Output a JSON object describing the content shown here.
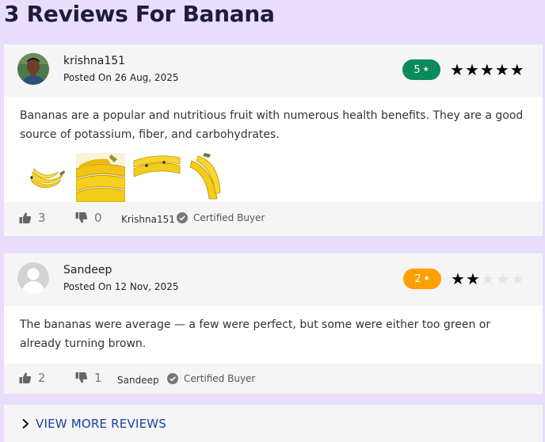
{
  "page": {
    "title": "3 Reviews For Banana"
  },
  "reviews": [
    {
      "author": "krishna151",
      "posted": "Posted On 26 Aug, 2025",
      "rating_badge": "5",
      "rating": 5,
      "max_rating": 5,
      "badge_color": "#0b8a5b",
      "text": "Bananas are a popular and nutritious fruit with numerous health benefits. They are a good source of potassium, fiber, and carbohydrates.",
      "likes": "3",
      "dislikes": "0",
      "footer_name": "Krishna151",
      "certified": "Certified Buyer",
      "images": [
        "banana-photo-1",
        "banana-photo-2",
        "banana-photo-3",
        "banana-photo-4"
      ]
    },
    {
      "author": "Sandeep",
      "posted": "Posted On 12 Nov, 2025",
      "rating_badge": "2",
      "rating": 2,
      "max_rating": 5,
      "badge_color": "#ff9f00",
      "text": "The bananas were average — a few were perfect, but some were either too green or already turning brown.",
      "likes": "2",
      "dislikes": "1",
      "footer_name": "Sandeep",
      "certified": "Certified Buyer"
    }
  ],
  "view_more": {
    "label": "VIEW MORE REVIEWS"
  },
  "colors": {
    "background": "#e9ddfb",
    "link": "#1a3fa6"
  }
}
